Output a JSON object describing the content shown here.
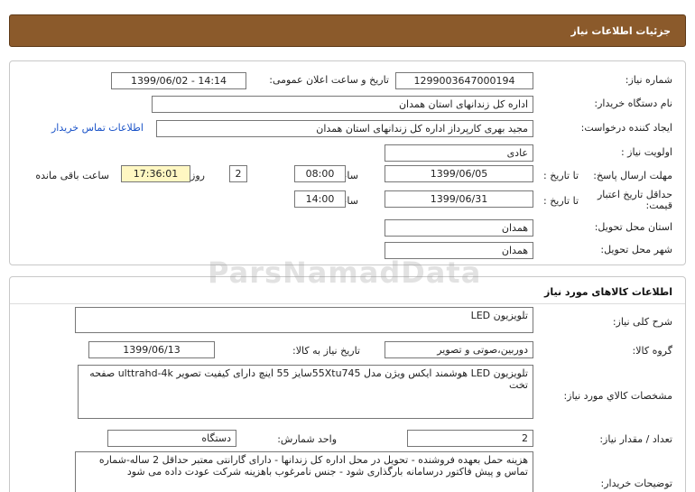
{
  "header": {
    "title": "جزئیات اطلاعات نیاز"
  },
  "details": {
    "need_number_label": "شماره نیاز:",
    "need_number": "1299003647000194",
    "announce_label": "تاریخ و ساعت اعلان عمومی:",
    "announce_value": "1399/06/02 - 14:14",
    "buyer_label": "نام دستگاه خریدار:",
    "buyer_value": "اداره کل زندانهای استان همدان",
    "creator_label": "ایجاد کننده درخواست:",
    "creator_value": "مجید بهری کارپرداز اداره کل زندانهای استان همدان",
    "contact_link": "اطلاعات تماس خریدار",
    "priority_label": "اولویت نیاز :",
    "priority_value": "عادی",
    "deadline_label": "مهلت ارسال پاسخ:",
    "deadline_to_label": "تا تاریخ :",
    "deadline_date": "1399/06/05",
    "deadline_time_label": "ساعت",
    "deadline_time": "08:00",
    "days_value": "2",
    "days_label": "روز و",
    "remaining_value": "17:36:01",
    "remaining_label": "ساعت باقی مانده",
    "validity_label_1": "حداقل تاریخ اعتبار",
    "validity_label_2": "قیمت:",
    "validity_to_label": "تا تاریخ :",
    "validity_date": "1399/06/31",
    "validity_time_label": "ساعت",
    "validity_time": "14:00",
    "province_label": "استان محل تحویل:",
    "province_value": "همدان",
    "city_label": "شهر محل تحویل:",
    "city_value": "همدان"
  },
  "goods": {
    "section_title": "اطلاعات کالاهای مورد نیاز",
    "watermark": "ParsNamadData",
    "summary_label": "شرح کلی نیاز:",
    "summary_value": "تلویزیون LED",
    "group_label": "گروه کالا:",
    "group_value": "دوربین،صوتی و تصویر",
    "need_date_label": "تاریخ نیاز به کالا:",
    "need_date_value": "1399/06/13",
    "specs_label": "مشخصات کالاي مورد نياز:",
    "specs_value": "تلویزیون LED هوشمند ایکس ویژن مدل 55Xtu745سایز 55 اینچ  دارای کیفیت تصویر ulttrahd-4k صفحه تخت",
    "count_label": "تعداد / مقدار نیاز:",
    "count_value": "2",
    "unit_label": "واحد شمارش:",
    "unit_value": "دستگاه",
    "notes_label": "توضیحات خریدار:",
    "notes_value": "هزینه حمل بعهده فروشنده - تحویل در محل اداره کل زندانها - دارای گارانتی معتبر حداقل 2 ساله-شماره تماس و پیش فاکتور درسامانه بارگذاری شود - جنس نامرغوب باهزینه شرکت عودت داده می شود"
  }
}
